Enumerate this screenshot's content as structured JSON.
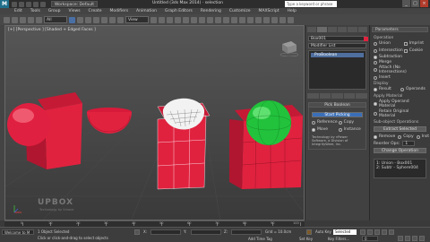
{
  "titlebar": {
    "workspace": "Workspace: Default",
    "title": "Untitled (3ds Max 2014) · selection",
    "search_placeholder": "Type a keyword or phrase"
  },
  "menu": [
    "Edit",
    "Tools",
    "Group",
    "Views",
    "Create",
    "Modifiers",
    "Animation",
    "Graph Editors",
    "Rendering",
    "Customize",
    "MAXScript",
    "Help"
  ],
  "toolbar": {
    "filter": "All",
    "coord": "View"
  },
  "viewport": {
    "label": "[+] [Perspective ] [Shaded + Edged Faces ]",
    "watermark": "UPBOX",
    "watermark_sub": "Technology by Vmane"
  },
  "command_panel": {
    "object_name": "Box001",
    "modifier_list": "Modifier List",
    "stack_item": "ProBoolean",
    "pick_rollout": "Pick Boolean",
    "start_picking": "Start Picking",
    "reference": "Reference",
    "copy": "Copy",
    "move": "Move",
    "instance": "Instance",
    "tech_note": "Technology by nPower Software, a Division of IntegrityWare, Inc."
  },
  "parameters": {
    "title": "Parameters",
    "operation": "Operation",
    "ops": [
      "Union",
      "Intersection",
      "Subtraction",
      "Merge",
      "Attach (No Intersections)",
      "Insert"
    ],
    "ops_right": [
      "Imprint",
      "Cookie"
    ],
    "display": "Display",
    "display_opts": [
      "Result",
      "Operands"
    ],
    "apply_material": "Apply Material",
    "mat_opts": [
      "Apply Operand Material",
      "Retain Original Material"
    ],
    "sub_ops": "Sub-object Operations",
    "extract_selected": "Extract Selected",
    "sub_opts": [
      "Remove",
      "Copy",
      "Inst"
    ],
    "reorder": "Reorder Ops:",
    "reorder_val": "1",
    "change_operation": "Change Operation",
    "operands": [
      "1: Union - Box001",
      "2: Subtr - Sphere004"
    ]
  },
  "timeline": {
    "ticks": [
      "0",
      "10",
      "20",
      "30",
      "40",
      "50",
      "60",
      "70",
      "80",
      "90",
      "100"
    ]
  },
  "statusbar": {
    "selected": "1 Object Selected",
    "prompt": "Click or click-and-drag to select objects",
    "x": "X:",
    "y": "Y:",
    "z": "Z:",
    "grid": "Grid = 10.0cm",
    "autokey": "Auto Key",
    "selected_dropdown": "Selected",
    "set_key": "Set Key",
    "key_filters": "Key Filters...",
    "add_time_tag": "Add Time Tag",
    "frame": "0",
    "welcome": "Welcome to M"
  },
  "colors": {
    "object_red": "#e0223f",
    "sphere_green": "#22c23c",
    "accent_blue": "#3a6fb8"
  }
}
